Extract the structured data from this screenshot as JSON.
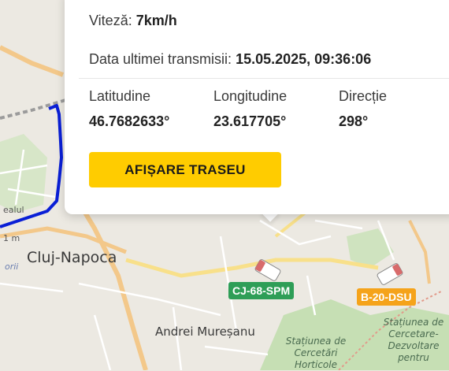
{
  "map": {
    "city_label": "Cluj-Napoca",
    "district_label": "Andrei Mureșanu",
    "station_label_1": "Stațiunea de Cercetări Horticole",
    "station_label_2": "Stațiunea de Cercetare-Dezvoltare pentru",
    "partial_label_1": "ealul",
    "partial_label_2": "1 m",
    "partial_label_3": "orii",
    "route_color": "#0a1fd6",
    "vehicles": [
      {
        "plate": "CJ-68-SPM",
        "badge_color": "#2e9e57"
      },
      {
        "plate": "B-20-DSU",
        "badge_color": "#f5a31a"
      }
    ]
  },
  "popup": {
    "speed_label": "Viteză:",
    "speed_value": "7km/h",
    "last_transmission_label": "Data ultimei transmisii:",
    "last_transmission_value": "15.05.2025, 09:36:06",
    "latitude_label": "Latitudine",
    "latitude_value": "46.7682633°",
    "longitude_label": "Longitudine",
    "longitude_value": "23.617705°",
    "direction_label": "Direcție",
    "direction_value": "298°",
    "show_route_button": "AFIȘARE TRASEU",
    "button_color": "#ffcc00"
  }
}
